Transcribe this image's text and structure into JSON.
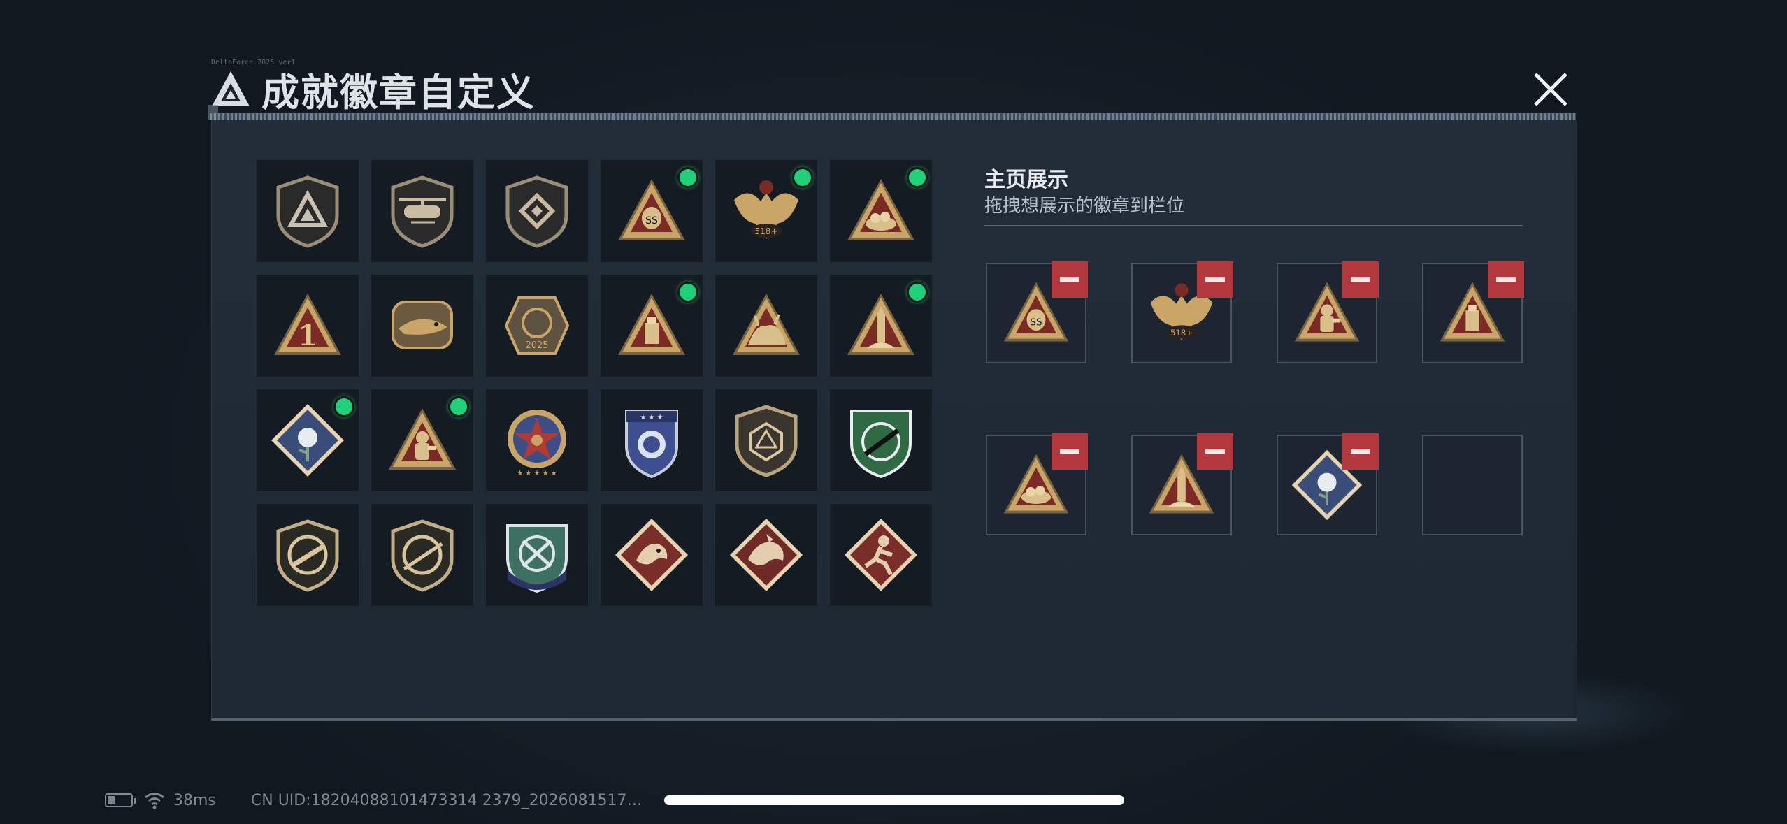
{
  "header": {
    "title": "成就徽章自定义",
    "small_code": "DeltaForce 2025 ver1",
    "close_icon": "close-x-icon",
    "logo_icon": "delta-triangle-logo-icon"
  },
  "badge_grid": {
    "rows": [
      [
        {
          "icon": "delta-shield-badge",
          "new": false
        },
        {
          "icon": "helicopter-shield-badge",
          "new": false
        },
        {
          "icon": "hex-diamond-shield-badge",
          "new": false
        },
        {
          "icon": "ss-bag-triangle-badge",
          "new": true
        },
        {
          "icon": "winged-518-emblem-badge",
          "new": true
        },
        {
          "icon": "nest-triangle-badge",
          "new": true
        }
      ],
      [
        {
          "icon": "number-one-triangle-badge",
          "new": false
        },
        {
          "icon": "delta-force-crocodile-badge",
          "new": false
        },
        {
          "icon": "delta-force-2025-badge",
          "new": false
        },
        {
          "icon": "usb-drive-triangle-badge",
          "new": true
        },
        {
          "icon": "beast-triangle-badge",
          "new": false
        },
        {
          "icon": "rocket-triangle-badge",
          "new": true
        }
      ],
      [
        {
          "icon": "rose-diamond-badge",
          "new": true
        },
        {
          "icon": "hazmat-soldier-triangle-badge",
          "new": true
        },
        {
          "icon": "star-medal-badge",
          "new": false
        },
        {
          "icon": "blue-police-shield-badge",
          "new": false
        },
        {
          "icon": "d20-dice-shield-badge",
          "new": false
        },
        {
          "icon": "green-rifle-shield-badge",
          "new": false
        }
      ],
      [
        {
          "icon": "smg-circle-shield-badge",
          "new": false
        },
        {
          "icon": "sniper-circle-shield-badge",
          "new": false
        },
        {
          "icon": "blue-crossed-knives-shield-badge",
          "new": false
        },
        {
          "icon": "dragon-diamond-badge",
          "new": false
        },
        {
          "icon": "dragon-diamond-badge-2",
          "new": false
        },
        {
          "icon": "runner-diamond-badge",
          "new": false
        }
      ]
    ]
  },
  "showcase": {
    "title": "主页展示",
    "subtitle": "拖拽想展示的徽章到栏位",
    "slots": [
      {
        "icon": "ss-bag-triangle-badge",
        "filled": true
      },
      {
        "icon": "winged-518-emblem-badge",
        "filled": true
      },
      {
        "icon": "hazmat-soldier-triangle-badge",
        "filled": true
      },
      {
        "icon": "usb-drive-triangle-badge",
        "filled": true
      },
      {
        "icon": "nest-triangle-badge",
        "filled": true
      },
      {
        "icon": "rocket-triangle-badge",
        "filled": true
      },
      {
        "icon": "rose-diamond-badge",
        "filled": true
      },
      {
        "icon": "",
        "filled": false
      }
    ]
  },
  "footer": {
    "latency": "38ms",
    "uid": "CN UID:18204088101473314 2379_2026081517…",
    "battery_icon": "battery-icon",
    "wifi_icon": "wifi-icon"
  },
  "colors": {
    "accent_new": "#1fd27a",
    "remove_red": "#b3383d",
    "gold": "#c9a567",
    "triangle_red": "#7b2a26"
  }
}
